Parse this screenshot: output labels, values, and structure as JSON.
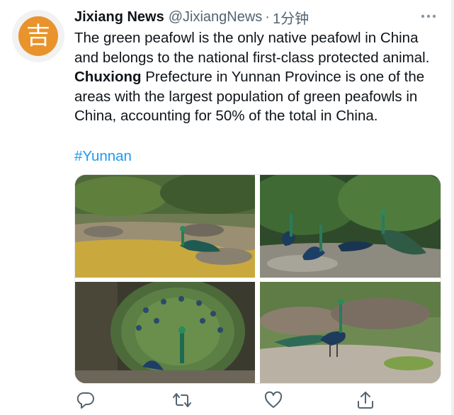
{
  "tweet": {
    "display_name": "Jixiang News",
    "handle": "@JixiangNews",
    "separator": "·",
    "time": "1分钟",
    "avatar_glyph": "吉",
    "text_part1": "The green peafowl is the only native peafowl in China and belongs to the national first-class protected animal. ",
    "text_bold": "Chuxiong",
    "text_part2": " Prefecture in Yunnan Province is one of the areas with the largest population of green peafowls in China, accounting for 50% of the total in China.",
    "hashtag": "#Yunnan"
  },
  "media": {
    "photos": [
      {
        "name": "photo-peafowl-river",
        "icon": "photo"
      },
      {
        "name": "photo-peafowl-group",
        "icon": "photo"
      },
      {
        "name": "photo-peafowl-display",
        "icon": "photo"
      },
      {
        "name": "photo-peafowl-rocks",
        "icon": "photo"
      }
    ]
  },
  "actions": {
    "icons": [
      "reply-icon",
      "retweet-icon",
      "like-icon",
      "share-icon"
    ]
  },
  "colors": {
    "accent": "#1d9bf0",
    "text": "#0f1419",
    "secondary": "#536471",
    "avatar_bg": "#e8932c"
  }
}
